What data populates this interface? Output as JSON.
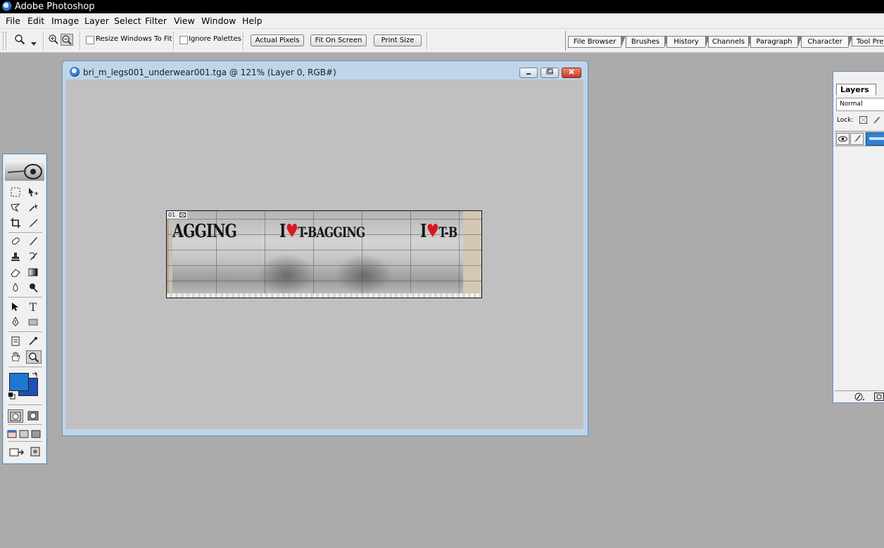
{
  "app": {
    "title": "Adobe Photoshop"
  },
  "menu": [
    "File",
    "Edit",
    "Image",
    "Layer",
    "Select",
    "Filter",
    "View",
    "Window",
    "Help"
  ],
  "options_bar": {
    "resize_windows_label": "Resize Windows To Fit",
    "ignore_palettes_label": "Ignore Palettes",
    "actual_pixels_label": "Actual Pixels",
    "fit_on_screen_label": "Fit On Screen",
    "print_size_label": "Print Size"
  },
  "palette_well": [
    "File Browser",
    "Brushes",
    "History",
    "Channels",
    "Paragraph",
    "Character",
    "Tool Pre"
  ],
  "document": {
    "title": "bri_m_legs001_underwear001.tga @ 121% (Layer 0, RGB#)",
    "layer_badge": "01",
    "image_text_left": "AGGING",
    "image_text_center_prefix": "I",
    "image_text_center_heart": "♥",
    "image_text_center_suffix": "T-BAGGING",
    "image_text_right_prefix": "I",
    "image_text_right_heart": "♥",
    "image_text_right_suffix": "T-B"
  },
  "layers_panel": {
    "tab_label": "Layers",
    "blend_mode": "Normal",
    "lock_label": "Lock:"
  },
  "colors": {
    "foreground": "#1e78d0",
    "background": "#1f4fb8"
  },
  "icons": {
    "zoom_tool": "magnifier-icon",
    "zoom_in": "zoom-in-icon",
    "zoom_out": "zoom-out-icon"
  }
}
